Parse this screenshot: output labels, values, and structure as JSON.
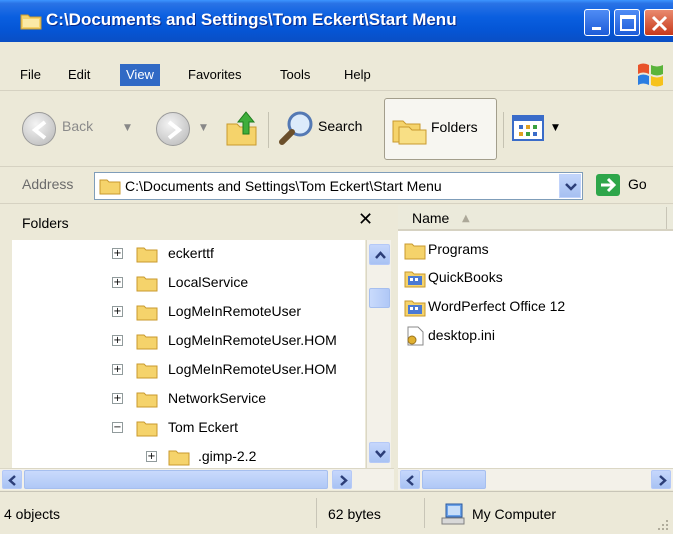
{
  "window": {
    "title": "C:\\Documents and Settings\\Tom Eckert\\Start Menu",
    "titlebar_color": "#0a5fe0",
    "icons": {
      "title": "folder-icon",
      "minimize": "minimize-icon",
      "maximize": "maximize-icon",
      "close": "close-icon"
    }
  },
  "menubar": {
    "items": [
      "File",
      "Edit",
      "View",
      "Favorites",
      "Tools",
      "Help"
    ],
    "active": "View",
    "logo_icon": "windows-flag-icon"
  },
  "toolbar": {
    "back_label": "Back",
    "search_label": "Search",
    "folders_label": "Folders",
    "icons": {
      "back": "back-arrow-icon",
      "forward": "forward-arrow-icon",
      "up": "up-folder-icon",
      "search": "search-magnifier-icon",
      "folders": "folders-icon",
      "views": "views-icon"
    }
  },
  "address": {
    "label": "Address",
    "value": "C:\\Documents and Settings\\Tom Eckert\\Start Menu",
    "go_label": "Go"
  },
  "folders_pane": {
    "title": "Folders",
    "close_glyph": "✕",
    "tree": [
      {
        "label": "eckerttf",
        "expander": "+"
      },
      {
        "label": "LocalService",
        "expander": "+"
      },
      {
        "label": "LogMeInRemoteUser",
        "expander": "+"
      },
      {
        "label": "LogMeInRemoteUser.HOM",
        "expander": "+"
      },
      {
        "label": "LogMeInRemoteUser.HOM",
        "expander": "+"
      },
      {
        "label": "NetworkService",
        "expander": "+"
      },
      {
        "label": "Tom Eckert",
        "expander": "−"
      },
      {
        "label": ".gimp-2.2",
        "expander": "+"
      }
    ]
  },
  "file_list": {
    "column_name": "Name",
    "sort_glyph": "▲",
    "items": [
      {
        "label": "Programs",
        "icon": "folder-icon"
      },
      {
        "label": "QuickBooks",
        "icon": "program-group-icon"
      },
      {
        "label": "WordPerfect Office 12",
        "icon": "program-group-icon"
      },
      {
        "label": "desktop.ini",
        "icon": "settings-file-icon"
      }
    ]
  },
  "statusbar": {
    "objects": "4 objects",
    "size": "62 bytes",
    "location": "My Computer"
  }
}
